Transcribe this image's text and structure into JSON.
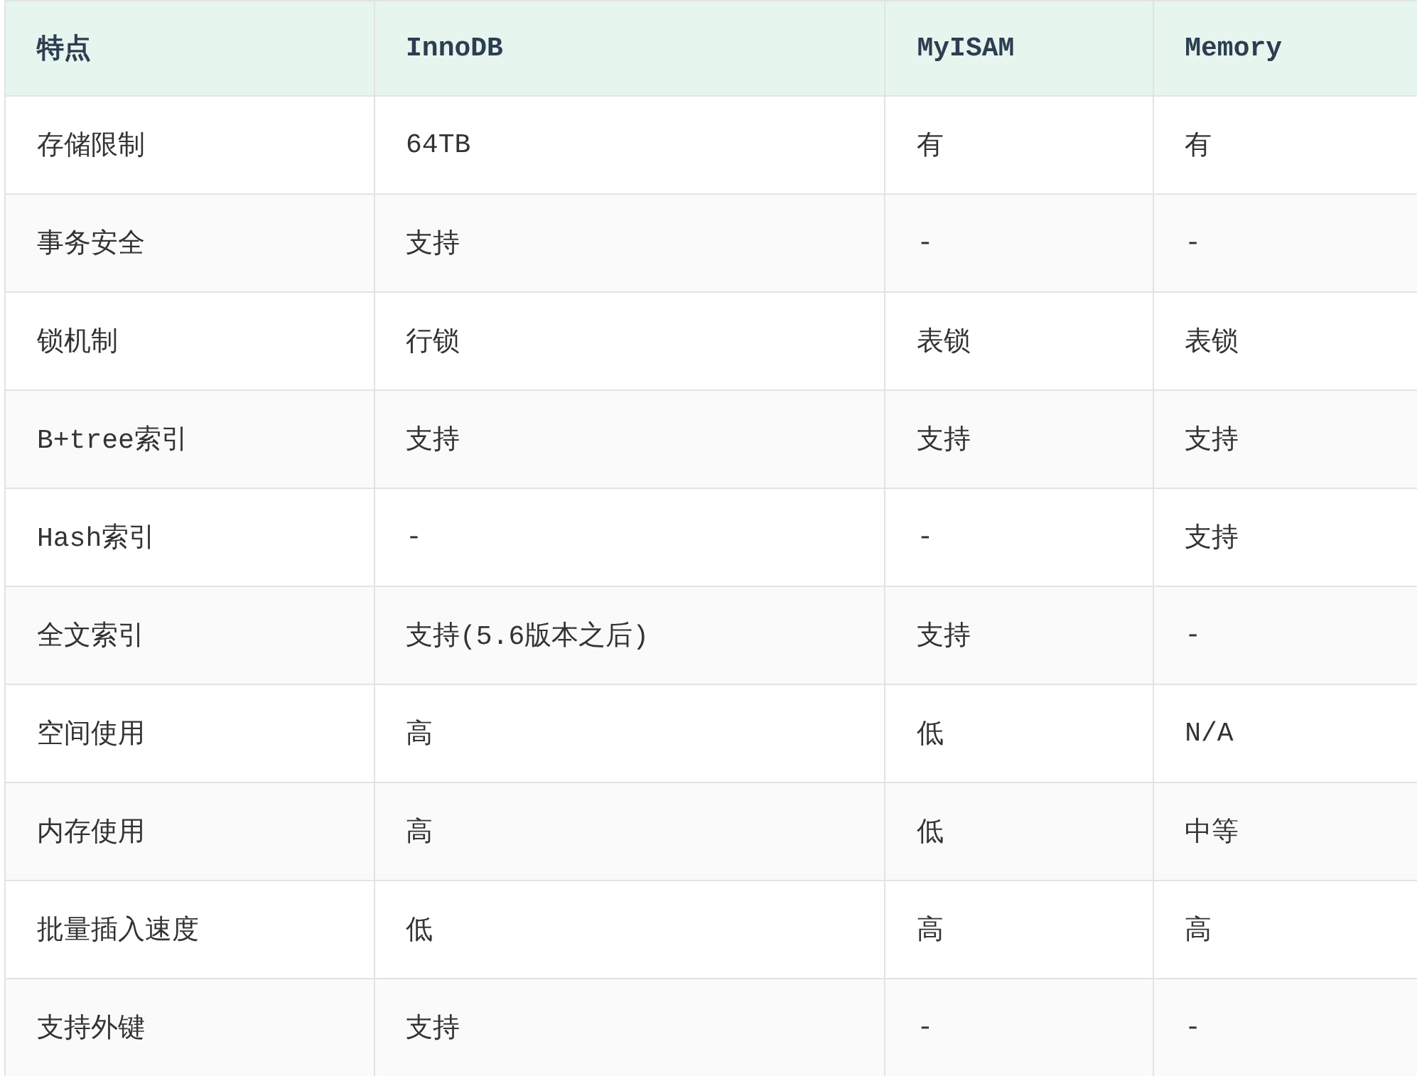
{
  "table": {
    "columns": [
      "特点",
      "InnoDB",
      "MyISAM",
      "Memory"
    ],
    "rows": [
      [
        "存储限制",
        "64TB",
        "有",
        "有"
      ],
      [
        "事务安全",
        "支持",
        "-",
        "-"
      ],
      [
        "锁机制",
        "行锁",
        "表锁",
        "表锁"
      ],
      [
        "B+tree索引",
        "支持",
        "支持",
        "支持"
      ],
      [
        "Hash索引",
        "-",
        "-",
        "支持"
      ],
      [
        "全文索引",
        "支持(5.6版本之后)",
        "支持",
        "-"
      ],
      [
        "空间使用",
        "高",
        "低",
        "N/A"
      ],
      [
        "内存使用",
        "高",
        "低",
        "中等"
      ],
      [
        "批量插入速度",
        "低",
        "高",
        "高"
      ],
      [
        "支持外键",
        "支持",
        "-",
        "-"
      ]
    ]
  }
}
